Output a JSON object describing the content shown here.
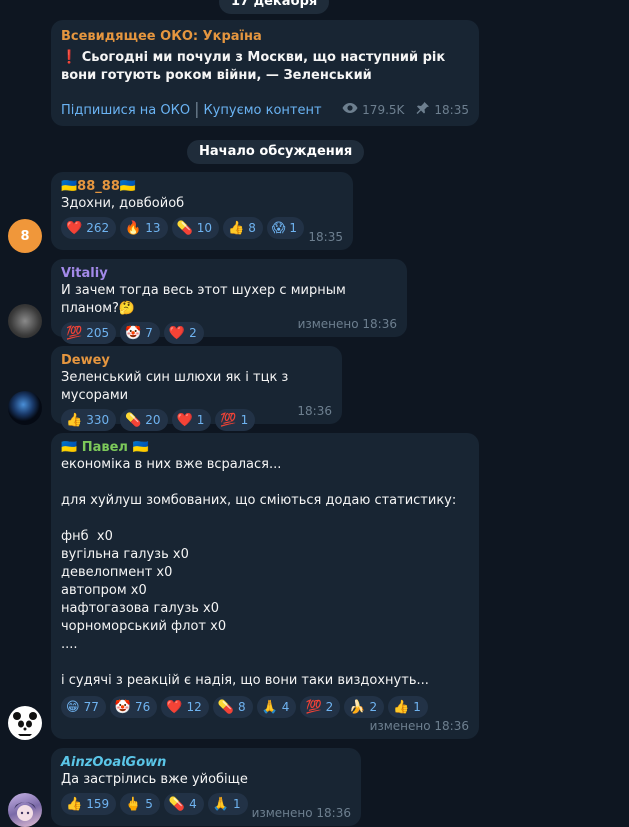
{
  "date_pill": "17 декабря",
  "discussion_pill": "Начало обсуждения",
  "channel_post": {
    "channel": "Всевидящее ОКО: Україна",
    "emoji": "❗",
    "text": "Сьогодні ми почули з Москви, що наступний рік вони готують роком війни, — Зеленський",
    "link_subscribe": "Підпишися на ОКО",
    "link_separator": "|",
    "link_buy": "Купуємо контент",
    "views": "179.5K",
    "time": "18:35"
  },
  "messages": [
    {
      "author": "🇺🇦88_88🇺🇦",
      "author_color": "#e5963f",
      "avatar": {
        "letter": "8",
        "bg": "#f0973a"
      },
      "text": "Здохни, довбойоб",
      "reactions": [
        {
          "emoji": "❤️",
          "count": "262"
        },
        {
          "emoji": "🔥",
          "count": "13"
        },
        {
          "emoji": "💊",
          "count": "10"
        },
        {
          "emoji": "👍",
          "count": "8"
        },
        {
          "emoji": "😱",
          "count": "1"
        }
      ],
      "meta": "18:35"
    },
    {
      "author": "Vitaliy",
      "author_color": "#a38ae9",
      "text": "И зачем тогда весь этот шухер с мирным планом?🤔",
      "reactions": [
        {
          "emoji": "💯",
          "count": "205"
        },
        {
          "emoji": "🤡",
          "count": "7"
        },
        {
          "emoji": "❤️",
          "count": "2"
        }
      ],
      "meta": "изменено 18:36"
    },
    {
      "author": "Dewey",
      "author_color": "#e5963f",
      "text": "Зеленський син шлюхи як і тцк з мусорами",
      "reactions": [
        {
          "emoji": "👍",
          "count": "330"
        },
        {
          "emoji": "💊",
          "count": "20"
        },
        {
          "emoji": "❤️",
          "count": "1"
        },
        {
          "emoji": "💯",
          "count": "1"
        }
      ],
      "meta": "18:36"
    },
    {
      "author": "🇺🇦 Павел 🇺🇦",
      "author_color": "#7cc95a",
      "text": "економіка в них вже всралася...\n\nдля хуйлуш зомбованих, що сміються додаю статистику:\n\nфнб  х0\nвугільна галузь х0\nдевелопмент х0\nавтопром х0\nнафтогазова галузь х0\nчорноморський флот х0\n....\n\nі судячі з реакцій є надія, що вони таки виздохнуть...",
      "reactions": [
        {
          "emoji": "😁",
          "count": "77"
        },
        {
          "emoji": "🤡",
          "count": "76"
        },
        {
          "emoji": "❤️",
          "count": "12"
        },
        {
          "emoji": "💊",
          "count": "8"
        },
        {
          "emoji": "🙏",
          "count": "4"
        },
        {
          "emoji": "💯",
          "count": "2"
        },
        {
          "emoji": "🍌",
          "count": "2"
        },
        {
          "emoji": "👍",
          "count": "1"
        }
      ],
      "meta": "изменено 18:36"
    },
    {
      "author": "𝘼𝙞𝙣𝙯𝙊𝙤𝙖𝙡𝙂𝙤𝙬𝙣",
      "author_color": "#5bc6e8",
      "text": "Да застрілись вже уйобіще",
      "reactions": [
        {
          "emoji": "👍",
          "count": "159"
        },
        {
          "emoji": "🖕",
          "count": "5"
        },
        {
          "emoji": "💊",
          "count": "4"
        },
        {
          "emoji": "🙏",
          "count": "1"
        }
      ],
      "meta": "изменено 18:36"
    }
  ],
  "icons": {
    "views": "eye-icon",
    "pin": "pin-icon"
  }
}
